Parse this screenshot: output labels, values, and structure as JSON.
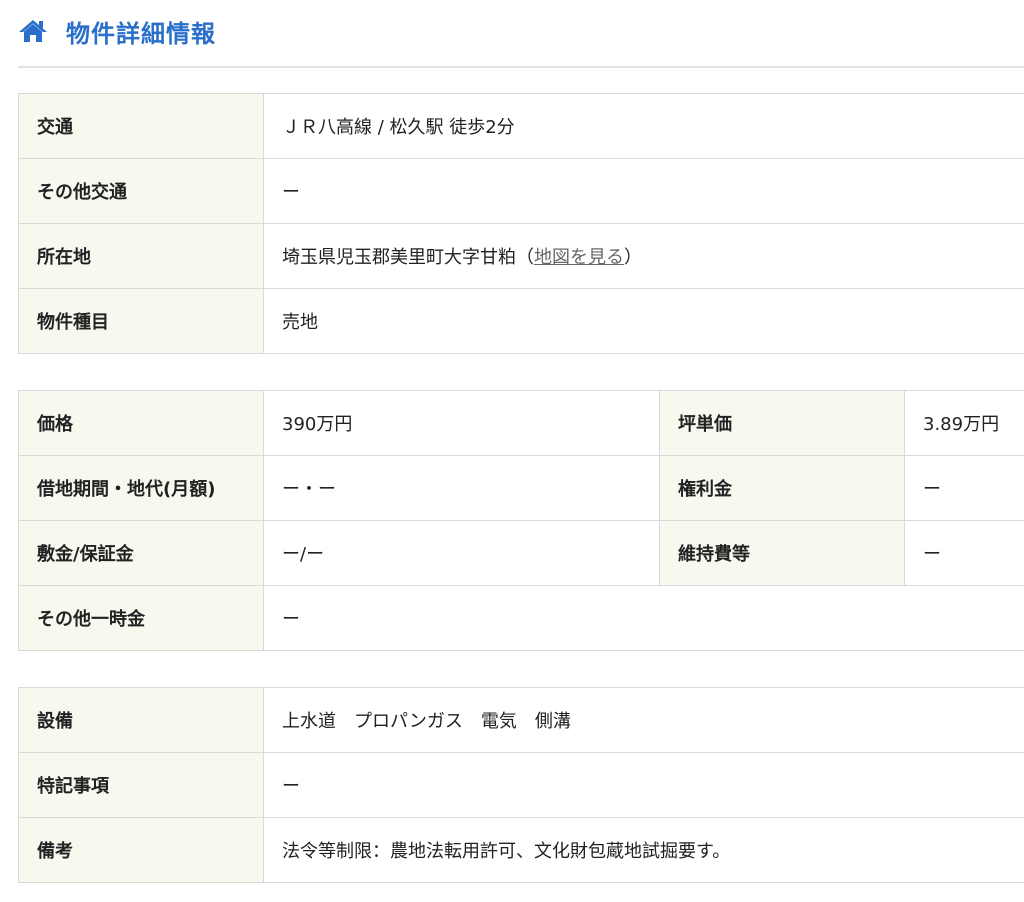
{
  "header": {
    "title": "物件詳細情報",
    "icon": "home-icon",
    "accent_color": "#2a6fc9"
  },
  "access_table": {
    "rows": [
      {
        "label": "交通",
        "value": "ＪＲ八高線 / 松久駅 徒歩2分"
      },
      {
        "label": "その他交通",
        "value": "ー"
      },
      {
        "label": "所在地",
        "value": "埼玉県児玉郡美里町大字甘粕",
        "link_open": "（",
        "link_label": "地図を見る",
        "link_close": "）"
      },
      {
        "label": "物件種目",
        "value": "売地"
      }
    ]
  },
  "price_table": {
    "rows": [
      {
        "label": "価格",
        "value": "390万円",
        "label2": "坪単価",
        "value2": "3.89万円"
      },
      {
        "label": "借地期間・地代(月額)",
        "value": "ー・ー",
        "label2": "権利金",
        "value2": "ー"
      },
      {
        "label": "敷金/保証金",
        "value": "ー/ー",
        "label2": "維持費等",
        "value2": "ー"
      },
      {
        "label": "その他一時金",
        "value": "ー"
      }
    ]
  },
  "facilities_table": {
    "rows": [
      {
        "label": "設備",
        "value": "上水道　プロパンガス　電気　側溝"
      },
      {
        "label": "特記事項",
        "value": "ー"
      },
      {
        "label": "備考",
        "value": "法令等制限：農地法転用許可、文化財包蔵地試掘要す。"
      }
    ]
  },
  "colors": {
    "label_background": "#f8f8ef",
    "border": "#d9d9d9",
    "divider": "#e3e3e3",
    "link": "#666666"
  }
}
